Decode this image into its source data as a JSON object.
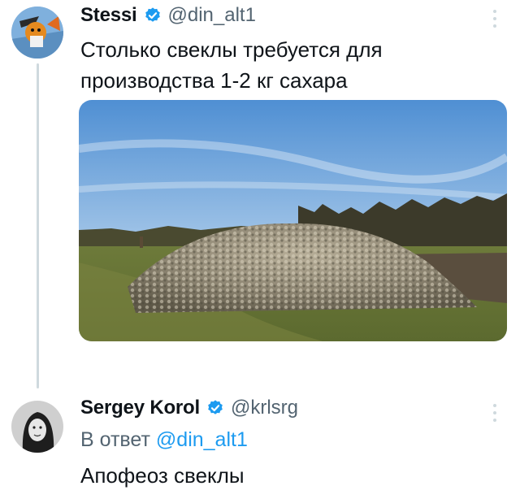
{
  "tweets": [
    {
      "author": {
        "name": "Stessi",
        "handle": "@din_alt1"
      },
      "text": "Столько свеклы требуется для производства 1-2 кг сахара",
      "media": {
        "type": "photo"
      }
    },
    {
      "author": {
        "name": "Sergey Korol",
        "handle": "@krlsrg"
      },
      "reply_prefix": "В ответ",
      "reply_mention": "@din_alt1",
      "text": "Апофеоз свеклы"
    }
  ],
  "colors": {
    "verified": "#1d9bf0",
    "mention": "#1d9bf0",
    "muted": "#536471"
  },
  "icons": [
    "verified-badge-icon",
    "more-options-icon"
  ]
}
